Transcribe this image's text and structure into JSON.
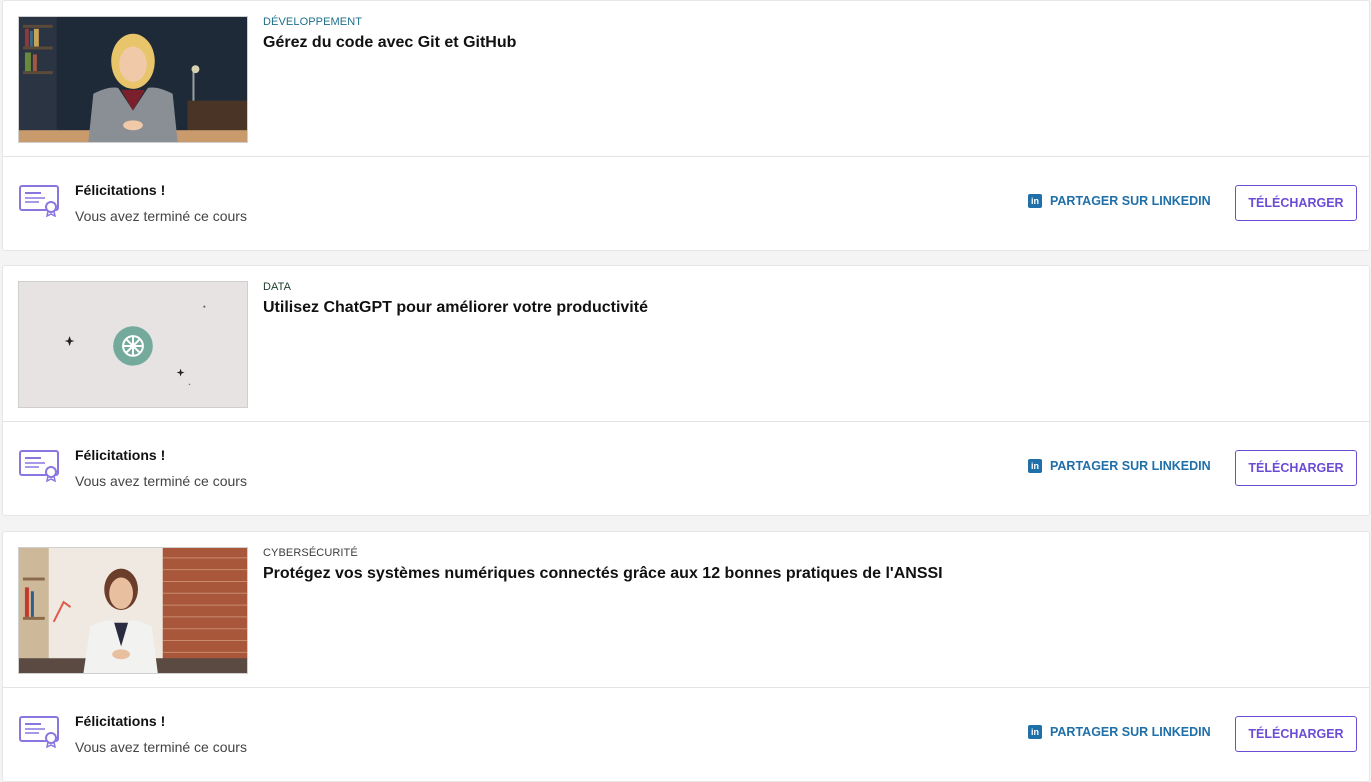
{
  "courses": [
    {
      "category": "DÉVELOPPEMENT",
      "title": "Gérez du code avec Git et GitHub",
      "thumbnail_icon": "instructor-woman-blonde-thumbnail",
      "congrats": "Félicitations !",
      "status": "Vous avez terminé ce cours",
      "share_label": "PARTAGER SUR LINKEDIN",
      "download_label": "TÉLÉCHARGER"
    },
    {
      "category": "DATA",
      "title": "Utilisez ChatGPT pour améliorer votre productivité",
      "thumbnail_icon": "chatgpt-logo-thumbnail",
      "congrats": "Félicitations !",
      "status": "Vous avez terminé ce cours",
      "share_label": "PARTAGER SUR LINKEDIN",
      "download_label": "TÉLÉCHARGER"
    },
    {
      "category": "CYBERSÉCURITÉ",
      "title": "Protégez vos systèmes numériques connectés grâce aux 12 bonnes pratiques de l'ANSSI",
      "thumbnail_icon": "instructor-woman-brick-wall-thumbnail",
      "congrats": "Félicitations !",
      "status": "Vous avez terminé ce cours",
      "share_label": "PARTAGER SUR LINKEDIN",
      "download_label": "TÉLÉCHARGER"
    }
  ],
  "colors": {
    "accent_purple": "#6b4cd6",
    "linkedin_blue": "#1f6fa8",
    "category_dev": "#1d6f8a",
    "category_data": "#1e3d2a",
    "chatgpt_green": "#74aa9c"
  }
}
